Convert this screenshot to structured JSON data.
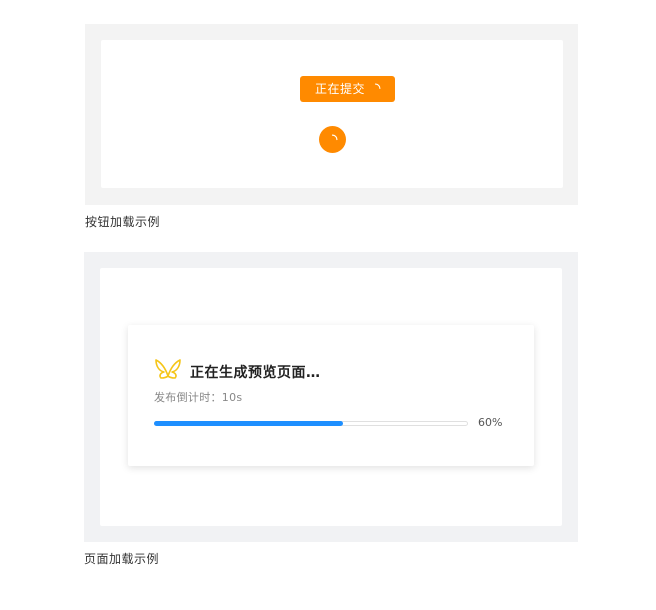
{
  "button_demo": {
    "button_label": "正在提交",
    "caption": "按钮加载示例"
  },
  "page_demo": {
    "title": "正在生成预览页面…",
    "countdown": "发布倒计时：10s",
    "progress_percent": 60,
    "progress_text": "60%",
    "caption": "页面加载示例",
    "icon": "butterfly-logo-icon"
  },
  "colors": {
    "accent_orange": "#ff8a00",
    "progress_blue": "#1e8fff",
    "logo_yellow": "#f5c518"
  }
}
